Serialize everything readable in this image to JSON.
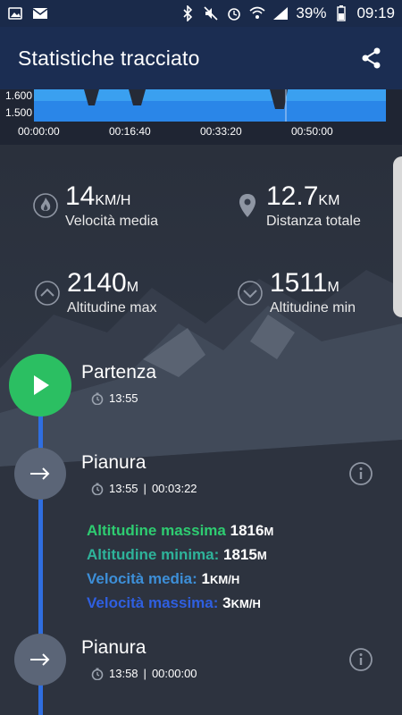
{
  "status_bar": {
    "battery": "39%",
    "time": "09:19"
  },
  "app_bar": {
    "title": "Statistiche tracciato"
  },
  "chart_data": {
    "type": "area",
    "y_ticks": [
      "1.600",
      "1.500"
    ],
    "x_ticks": [
      "00:00:00",
      "00:16:40",
      "00:33:20",
      "00:50:00"
    ]
  },
  "stats": {
    "speed": {
      "value": "14",
      "unit": "KM/H",
      "label": "Velocità media"
    },
    "distance": {
      "value": "12.7",
      "unit": "KM",
      "label": "Distanza totale"
    },
    "alt_max": {
      "value": "2140",
      "unit": "M",
      "label": "Altitudine max"
    },
    "alt_min": {
      "value": "1511",
      "unit": "M",
      "label": "Altitudine min"
    }
  },
  "timeline": {
    "start": {
      "title": "Partenza",
      "time": "13:55"
    },
    "seg1": {
      "title": "Pianura",
      "time": "13:55",
      "sep": "|",
      "duration": "00:03:22",
      "details": [
        {
          "label": "Altitudine massima",
          "value": "1816",
          "unit": "M",
          "color": "#2ecc71"
        },
        {
          "label": "Altitudine minima:",
          "value": "1815",
          "unit": "M",
          "color": "#2eb39a"
        },
        {
          "label": "Velocità media:",
          "value": "1",
          "unit": "KM/H",
          "color": "#3d8fd8"
        },
        {
          "label": "Velocità massima:",
          "value": "3",
          "unit": "KM/H",
          "color": "#2f5fe0"
        }
      ]
    },
    "seg2": {
      "title": "Pianura",
      "time": "13:58",
      "sep": "|",
      "duration": "00:00:00"
    }
  },
  "colors": {
    "accent_blue": "#2f6ee0",
    "start_green": "#2bbf62"
  }
}
